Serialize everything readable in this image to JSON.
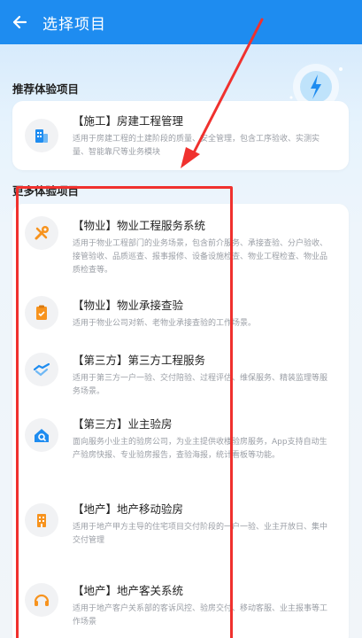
{
  "header": {
    "title": "选择项目",
    "back_icon": "arrow-left-icon"
  },
  "recommended": {
    "title": "推荐体验项目",
    "items": [
      {
        "title": "【施工】房建工程管理",
        "desc": "适用于房建工程的土建阶段的质量、安全管理，包含工序验收、实测实量、智能靠尺等业务模块",
        "icon": "building-icon"
      }
    ]
  },
  "more": {
    "title": "更多体验项目",
    "items": [
      {
        "title": "【物业】物业工程服务系统",
        "desc": "适用于物业工程部门的业务场景，包含前介服务、承接查验、分户验收、接管验收、品质巡查、报事报修、设备设施检查、物业工程检查、物业品质检查等。",
        "icon": "tools-icon"
      },
      {
        "title": "【物业】物业承接查验",
        "desc": "适用于物业公司对新、老物业承接查验的工作场景。",
        "icon": "clipboard-icon"
      },
      {
        "title": "【第三方】第三方工程服务",
        "desc": "适用于第三方一户一验、交付陪验、过程评估、维保服务、精装监理等服务场景。",
        "icon": "handshake-icon"
      },
      {
        "title": "【第三方】业主验房",
        "desc": "面向服务小业主的验房公司，为业主提供收楼验房服务，App支持自动生产验房快报、专业验房报告，查验海报，统计看板等功能。",
        "icon": "house-search-icon"
      },
      {
        "title": "【地产】地产移动验房",
        "desc": "适用于地产甲方主导的住宅项目交付阶段的一户一验、业主开放日、集中交付管理",
        "icon": "building-small-icon"
      },
      {
        "title": "【地产】地产客关系统",
        "desc": "适用于地产客户关系部的客诉风控、验房交付、移动客服、业主报事等工作场景",
        "icon": "headset-icon"
      }
    ]
  },
  "colors": {
    "header": "#1e8cf0",
    "accent": "#1e8cf0",
    "icon_orange": "#f7931e",
    "annotation_red": "#f0312e"
  }
}
